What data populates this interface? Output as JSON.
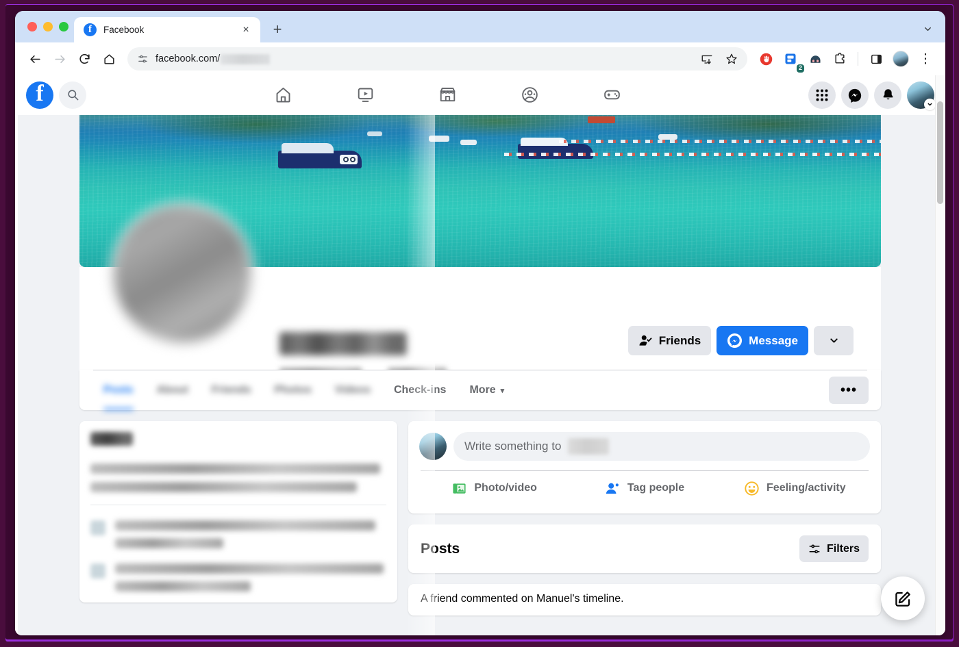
{
  "browser": {
    "traffic_lights": [
      "close",
      "minimize",
      "maximize"
    ],
    "tab": {
      "title": "Facebook",
      "favicon": "facebook-icon",
      "close_label": "×"
    },
    "new_tab_label": "+",
    "tab_list_caret": "⌄",
    "toolbar": {
      "back_icon": "←",
      "forward_icon": "→",
      "reload_icon": "⟳",
      "home_icon": "home-icon",
      "site_info_icon": "tune-icon",
      "url": "facebook.com/",
      "url_redacted": true,
      "install_icon": "install-app-icon",
      "bookmark_icon": "☆",
      "extensions": [
        {
          "name": "adblock-icon",
          "color": "#e63946"
        },
        {
          "name": "notes-extension-icon",
          "color": "#1a73e8",
          "badge": "2"
        },
        {
          "name": "avatar-extension-icon",
          "color": "#2d4a5e"
        },
        {
          "name": "puzzle-extensions-icon",
          "color": "#1f1f1f"
        }
      ],
      "side_panel_icon": "side-panel-icon",
      "profile_icon": "profile-avatar",
      "menu_icon": "⋮"
    }
  },
  "facebook": {
    "nav": {
      "logo": "facebook-logo",
      "search_icon": "search-icon",
      "tabs": [
        {
          "name": "home",
          "icon": "home-icon"
        },
        {
          "name": "video",
          "icon": "video-icon"
        },
        {
          "name": "marketplace",
          "icon": "marketplace-icon"
        },
        {
          "name": "groups",
          "icon": "groups-icon"
        },
        {
          "name": "gaming",
          "icon": "gaming-icon"
        }
      ],
      "right": [
        {
          "name": "menu-grid",
          "icon": "grid-icon"
        },
        {
          "name": "messenger",
          "icon": "messenger-icon"
        },
        {
          "name": "notifications",
          "icon": "bell-icon"
        },
        {
          "name": "account",
          "icon": "account-avatar"
        }
      ]
    },
    "profile": {
      "cover_photo_alt": "turquoise sea with speedboats",
      "avatar_alt": "profile picture (blurred)",
      "name_redacted": true,
      "friends_count_redacted": true,
      "actions": {
        "friends_label": "Friends",
        "friends_icon": "friend-check-icon",
        "message_label": "Message",
        "message_icon": "messenger-icon",
        "more_caret": "⌄"
      },
      "tabs": [
        {
          "label": "Posts",
          "selected": true,
          "blurred": true
        },
        {
          "label": "About",
          "selected": false,
          "blurred": true
        },
        {
          "label": "Friends",
          "selected": false,
          "blurred": true
        },
        {
          "label": "Photos",
          "selected": false,
          "blurred": true
        },
        {
          "label": "Videos",
          "selected": false,
          "blurred": true
        },
        {
          "label": "Check-ins",
          "selected": false,
          "blurred": false
        },
        {
          "label": "More",
          "selected": false,
          "blurred": false,
          "caret": "▾"
        }
      ],
      "overflow_label": "•••"
    },
    "intro_card": {
      "title_redacted": true,
      "bio_redacted": true,
      "detail_rows_redacted": 2
    },
    "composer": {
      "placeholder_prefix": "Write something to",
      "placeholder_name_redacted": true,
      "actions": [
        {
          "label": "Photo/video",
          "icon": "photo-video-icon",
          "color": "#45bd62"
        },
        {
          "label": "Tag people",
          "icon": "tag-people-icon",
          "color": "#1877f2"
        },
        {
          "label": "Feeling/activity",
          "icon": "feeling-activity-icon",
          "color": "#f7b928"
        }
      ]
    },
    "posts_section": {
      "title": "Posts",
      "filters_label": "Filters",
      "filters_icon": "filters-icon",
      "first_post_snippet": "A friend commented on Manuel's timeline."
    },
    "compose_fab_icon": "compose-pencil-icon"
  },
  "colors": {
    "fb_blue": "#1877f2",
    "grey_button": "#e4e6eb",
    "page_bg": "#f0f2f5",
    "frame_purple": "#9b2fe0",
    "frame_dark": "#4a0d3d"
  }
}
